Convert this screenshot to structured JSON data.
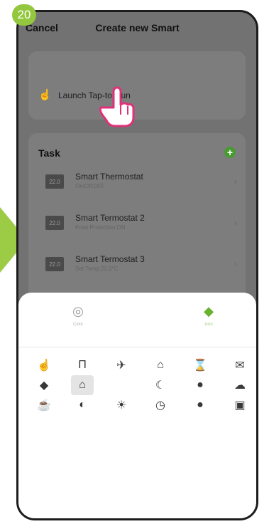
{
  "step_number": "20",
  "header": {
    "cancel_label": "Cancel",
    "title": "Create new Smart"
  },
  "launch": {
    "label": "Launch Tap-to-Run",
    "icon": "tap-hand-icon"
  },
  "task_section": {
    "title": "Task",
    "items": [
      {
        "name": "Smart Thermostat",
        "subtitle": "On/Off:OFF",
        "thumb": "22.0"
      },
      {
        "name": "Smart Termostat 2",
        "subtitle": "Frost Protection:ON",
        "thumb": "22.0"
      },
      {
        "name": "Smart Termostat 3",
        "subtitle": "Set Temp:22.0°C",
        "thumb": "22.0"
      }
    ]
  },
  "sheet": {
    "tabs": [
      {
        "label": "Color",
        "icon": "palette-icon"
      },
      {
        "label": "Icon",
        "icon": "tag-icon",
        "selected": true
      }
    ],
    "icons": [
      [
        {
          "name": "tap-hand",
          "glyph": "☝"
        },
        {
          "name": "curtains",
          "glyph": "Π"
        },
        {
          "name": "plane",
          "glyph": "✈"
        },
        {
          "name": "leave-home",
          "glyph": "⌂"
        },
        {
          "name": "hourglass",
          "glyph": "⌛"
        },
        {
          "name": "mail",
          "glyph": "✉"
        }
      ],
      [
        {
          "name": "tag",
          "glyph": "◆"
        },
        {
          "name": "home-walk",
          "glyph": "⌂",
          "selected": true
        },
        {
          "name": "blank",
          "glyph": ""
        },
        {
          "name": "moon",
          "glyph": "☾"
        },
        {
          "name": "location-pin",
          "glyph": "●"
        },
        {
          "name": "rain-cloud",
          "glyph": "☁"
        }
      ],
      [
        {
          "name": "coffee",
          "glyph": "☕"
        },
        {
          "name": "shield",
          "glyph": "◐"
        },
        {
          "name": "sun",
          "glyph": "☀"
        },
        {
          "name": "timer",
          "glyph": "◷"
        },
        {
          "name": "water-drop",
          "glyph": "●"
        },
        {
          "name": "briefcase",
          "glyph": "▣"
        }
      ]
    ]
  },
  "colors": {
    "badge": "#93c73d",
    "accent": "#6ab12d",
    "dim": "#727272"
  }
}
